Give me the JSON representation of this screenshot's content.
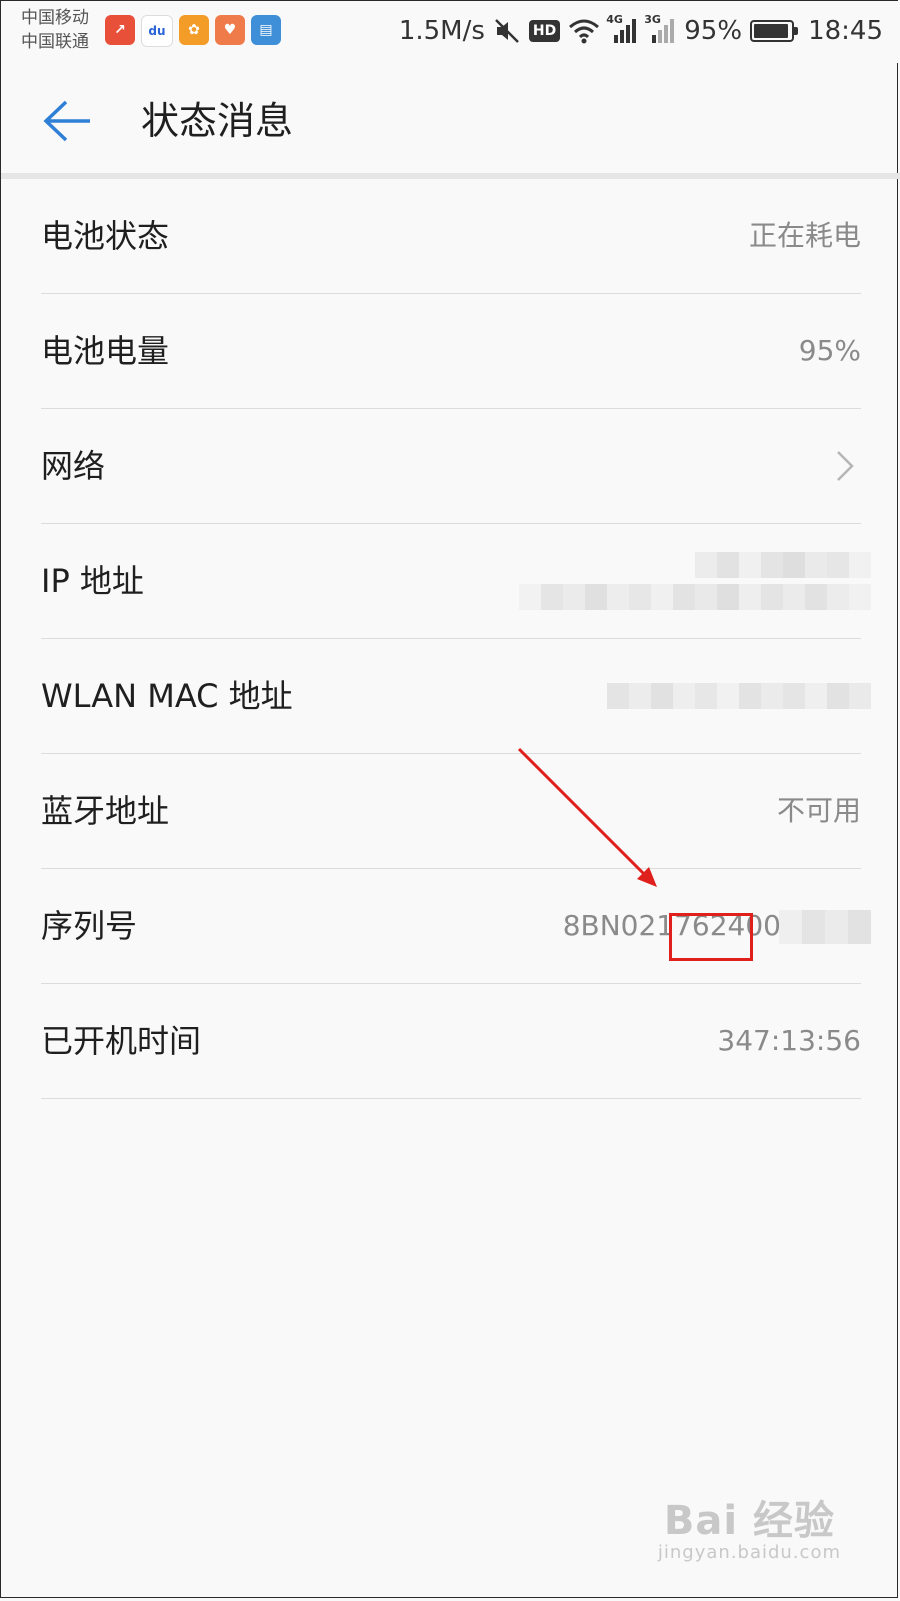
{
  "status_bar": {
    "carriers": [
      "中国移动",
      "中国联通"
    ],
    "app_icons": [
      {
        "name": "stock-app-icon",
        "color": "#e8503a",
        "glyph": "↗"
      },
      {
        "name": "baidu-icon",
        "color": "#ffffff",
        "glyph": "du"
      },
      {
        "name": "kuaishou-icon",
        "color": "#f39c28",
        "glyph": "✿"
      },
      {
        "name": "health-app-icon",
        "color": "#f07b4a",
        "glyph": "♥"
      },
      {
        "name": "reader-app-icon",
        "color": "#3e8fd8",
        "glyph": "▤"
      }
    ],
    "net_speed": "1.5M/s",
    "hd_label": "HD",
    "network_4g": "4G",
    "network_3g": "3G",
    "battery_percent": "95%",
    "battery_level": 0.95,
    "time": "18:45"
  },
  "header": {
    "title": "状态消息"
  },
  "rows": [
    {
      "label": "电池状态",
      "value": "正在耗电"
    },
    {
      "label": "电池电量",
      "value": "95%"
    },
    {
      "label": "网络",
      "value": ""
    },
    {
      "label": "IP 地址",
      "value": ""
    },
    {
      "label": "WLAN MAC 地址",
      "value": ""
    },
    {
      "label": "蓝牙地址",
      "value": "不可用"
    },
    {
      "label": "序列号",
      "value": "8BN021762400"
    },
    {
      "label": "已开机时间",
      "value": "347:13:56"
    }
  ],
  "annotation": {
    "color": "#e0201c"
  },
  "watermark": {
    "main": "Bai 经验",
    "sub": "jingyan.baidu.com"
  }
}
